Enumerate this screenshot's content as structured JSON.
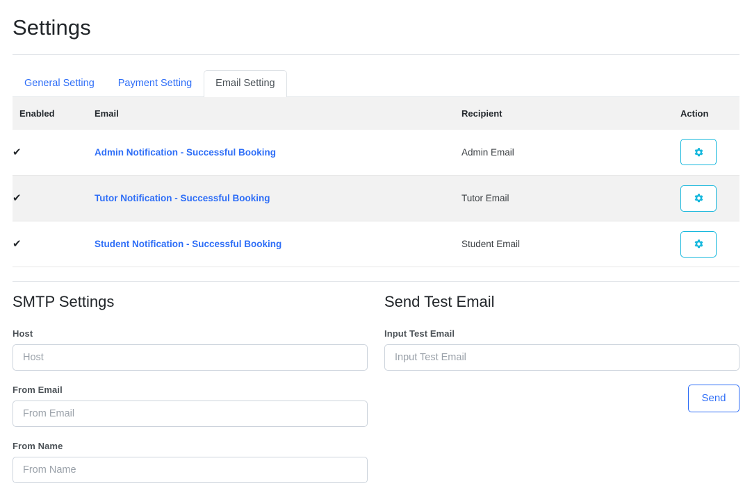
{
  "page": {
    "title": "Settings"
  },
  "tabs": [
    {
      "label": "General Setting",
      "active": false
    },
    {
      "label": "Payment Setting",
      "active": false
    },
    {
      "label": "Email Setting",
      "active": true
    }
  ],
  "table": {
    "columns": {
      "enabled": "Enabled",
      "email": "Email",
      "recipient": "Recipient",
      "action": "Action"
    },
    "rows": [
      {
        "enabled": "✔",
        "email": "Admin Notification - Successful Booking",
        "recipient": "Admin Email",
        "action_icon": "gear-icon"
      },
      {
        "enabled": "✔",
        "email": "Tutor Notification - Successful Booking",
        "recipient": "Tutor Email",
        "action_icon": "gear-icon"
      },
      {
        "enabled": "✔",
        "email": "Student Notification - Successful Booking",
        "recipient": "Student Email",
        "action_icon": "gear-icon"
      }
    ]
  },
  "smtp": {
    "heading": "SMTP Settings",
    "fields": [
      {
        "label": "Host",
        "placeholder": "Host",
        "value": ""
      },
      {
        "label": "From Email",
        "placeholder": "From Email",
        "value": ""
      },
      {
        "label": "From Name",
        "placeholder": "From Name",
        "value": ""
      }
    ]
  },
  "test_email": {
    "heading": "Send Test Email",
    "field": {
      "label": "Input Test Email",
      "placeholder": "Input Test Email",
      "value": ""
    },
    "send_label": "Send"
  },
  "colors": {
    "link_blue": "#2e6ef7",
    "gear_cyan": "#17b8dd",
    "header_bg": "#f2f2f2",
    "stripe_bg": "#f2f2f2",
    "border_gray": "#dee2e6",
    "input_border": "#ccd3dc"
  }
}
